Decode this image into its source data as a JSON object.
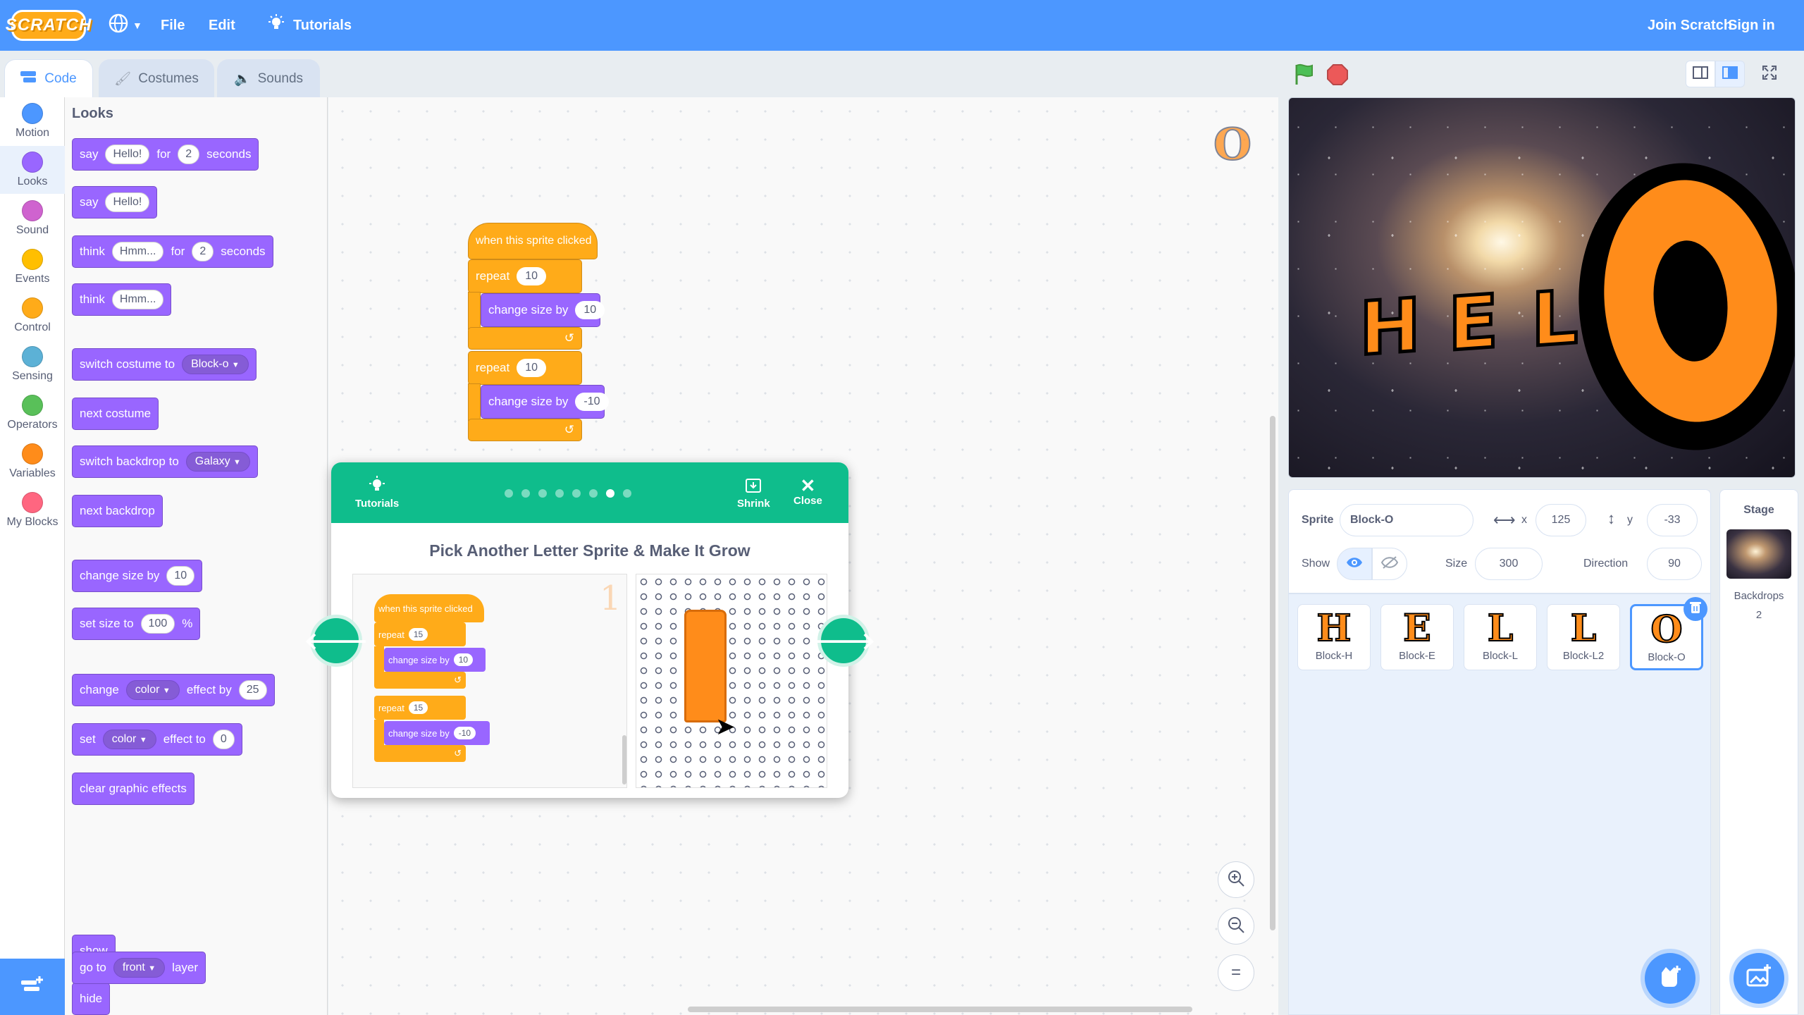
{
  "menubar": {
    "logo": "SCRATCH",
    "file": "File",
    "edit": "Edit",
    "tutorials": "Tutorials",
    "join": "Join Scratch",
    "signin": "Sign in"
  },
  "tabs": {
    "code": "Code",
    "costumes": "Costumes",
    "sounds": "Sounds"
  },
  "categories": [
    {
      "label": "Motion",
      "color": "#4c97ff"
    },
    {
      "label": "Looks",
      "color": "#9966ff"
    },
    {
      "label": "Sound",
      "color": "#cf63cf"
    },
    {
      "label": "Events",
      "color": "#ffbf00"
    },
    {
      "label": "Control",
      "color": "#ffab19"
    },
    {
      "label": "Sensing",
      "color": "#5cb1d6"
    },
    {
      "label": "Operators",
      "color": "#59c059"
    },
    {
      "label": "Variables",
      "color": "#ff8c1a"
    },
    {
      "label": "My Blocks",
      "color": "#ff6680"
    }
  ],
  "palette": {
    "title": "Looks",
    "say_for": {
      "a": "say",
      "b": "Hello!",
      "c": "for",
      "d": "2",
      "e": "seconds"
    },
    "say": {
      "a": "say",
      "b": "Hello!"
    },
    "think_for": {
      "a": "think",
      "b": "Hmm...",
      "c": "for",
      "d": "2",
      "e": "seconds"
    },
    "think": {
      "a": "think",
      "b": "Hmm..."
    },
    "switch_costume": {
      "a": "switch costume to",
      "b": "Block-o"
    },
    "next_costume": "next costume",
    "switch_backdrop": {
      "a": "switch backdrop to",
      "b": "Galaxy"
    },
    "next_backdrop": "next backdrop",
    "change_size": {
      "a": "change size by",
      "b": "10"
    },
    "set_size": {
      "a": "set size to",
      "b": "100",
      "c": "%"
    },
    "change_effect": {
      "a": "change",
      "b": "color",
      "c": "effect by",
      "d": "25"
    },
    "set_effect": {
      "a": "set",
      "b": "color",
      "c": "effect to",
      "d": "0"
    },
    "clear_effects": "clear graphic effects",
    "show": "show",
    "hide": "hide",
    "goto_layer": {
      "a": "go to",
      "b": "front",
      "c": "layer"
    }
  },
  "script": {
    "hat": "when this sprite clicked",
    "repeat1": {
      "label": "repeat",
      "value": "10"
    },
    "change1": {
      "label": "change size by",
      "value": "10"
    },
    "repeat2": {
      "label": "repeat",
      "value": "10"
    },
    "change2": {
      "label": "change size by",
      "value": "-10"
    }
  },
  "tutorial": {
    "tutorials_label": "Tutorials",
    "shrink": "Shrink",
    "close": "Close",
    "step_count": 8,
    "active_step": 7,
    "title": "Pick Another Letter Sprite & Make It Grow",
    "mini": {
      "hat": "when this sprite clicked",
      "repeat1": {
        "label": "repeat",
        "value": "15"
      },
      "change1": {
        "label": "change size by",
        "value": "10"
      },
      "repeat2": {
        "label": "repeat",
        "value": "15"
      },
      "change2": {
        "label": "change size by",
        "value": "-10"
      }
    }
  },
  "stage": {
    "letters": [
      "H",
      "E",
      "L",
      "O"
    ]
  },
  "sprite_info": {
    "sprite_label": "Sprite",
    "sprite_name": "Block-O",
    "x_label": "x",
    "x_value": "125",
    "y_label": "y",
    "y_value": "-33",
    "show_label": "Show",
    "size_label": "Size",
    "size_value": "300",
    "direction_label": "Direction",
    "direction_value": "90"
  },
  "sprites": [
    {
      "glyph": "H",
      "name": "Block-H"
    },
    {
      "glyph": "E",
      "name": "Block-E"
    },
    {
      "glyph": "L",
      "name": "Block-L"
    },
    {
      "glyph": "L",
      "name": "Block-L2"
    },
    {
      "glyph": "O",
      "name": "Block-O"
    }
  ],
  "stage_pane": {
    "title": "Stage",
    "backdrops_label": "Backdrops",
    "backdrops_count": "2"
  }
}
